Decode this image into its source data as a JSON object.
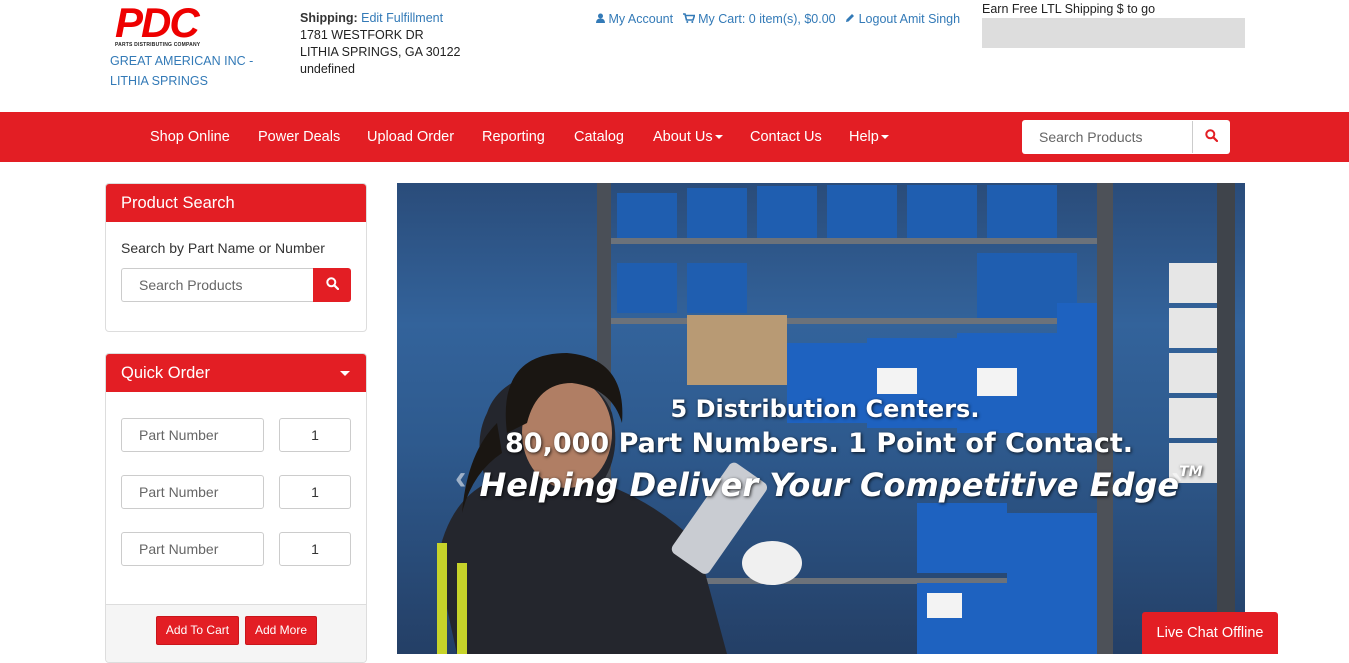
{
  "brand": {
    "logo_text": "PDC",
    "logo_sub": "PARTS DISTRIBUTING COMPANY",
    "company_line1": "GREAT AMERICAN INC -",
    "company_line2": "LITHIA SPRINGS"
  },
  "shipping": {
    "label": "Shipping:",
    "edit_link": "Edit Fulfillment",
    "address1": "1781 WESTFORK DR",
    "address2": "LITHIA SPRINGS, GA 30122",
    "address3": "undefined"
  },
  "user_links": {
    "account": "My Account",
    "cart": "My Cart: 0 item(s), $0.00",
    "logout": "Logout Amit Singh"
  },
  "ltl": {
    "text": "Earn Free LTL Shipping $ to go",
    "progress": 0
  },
  "nav": {
    "items": [
      {
        "label": "Shop Online"
      },
      {
        "label": "Power Deals"
      },
      {
        "label": "Upload Order"
      },
      {
        "label": "Reporting"
      },
      {
        "label": "Catalog"
      },
      {
        "label": "About Us"
      },
      {
        "label": "Contact Us"
      },
      {
        "label": "Help"
      }
    ],
    "search_placeholder": "Search Products"
  },
  "product_search": {
    "title": "Product Search",
    "label": "Search by Part Name or Number",
    "placeholder": "Search Products"
  },
  "quick_order": {
    "title": "Quick Order",
    "part_placeholder": "Part Number",
    "rows": [
      {
        "qty": "1"
      },
      {
        "qty": "1"
      },
      {
        "qty": "1"
      }
    ],
    "add_to_cart": "Add To Cart",
    "add_more": "Add More"
  },
  "hero": {
    "line1": "5 Distribution Centers.",
    "line2": "80,000 Part Numbers. 1 Point of Contact.",
    "line3": "Helping Deliver Your Competitive Edge",
    "trademark": "TM"
  },
  "live_chat": {
    "label": "Live Chat Offline"
  },
  "colors": {
    "brand_red": "#e31e24",
    "link_blue": "#337ab7"
  }
}
